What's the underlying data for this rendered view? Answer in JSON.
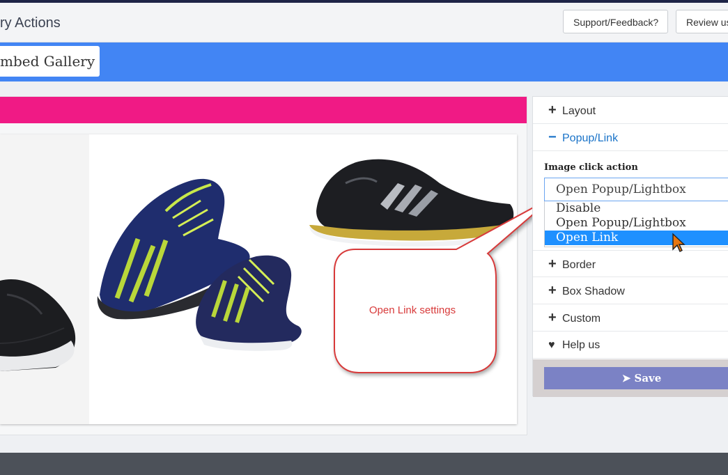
{
  "header": {
    "title": "ry Actions",
    "support_label": "Support/Feedback?",
    "review_label": "Review us"
  },
  "tabs": {
    "gallery_label": "mbed Gallery"
  },
  "sidebar": {
    "sections": [
      {
        "icon": "plus-icon",
        "label": "Layout"
      },
      {
        "icon": "minus-icon",
        "label": "Popup/Link"
      },
      {
        "icon": "plus-icon",
        "label": "Border"
      },
      {
        "icon": "plus-icon",
        "label": "Box Shadow"
      },
      {
        "icon": "plus-icon",
        "label": "Custom"
      },
      {
        "icon": "heart-icon",
        "label": "Help us"
      }
    ],
    "click_action": {
      "label": "Image click action",
      "value": "Open Popup/Lightbox",
      "options": [
        "Disable",
        "Open Popup/Lightbox",
        "Open Link"
      ],
      "highlighted": "Open Link"
    },
    "save_label": "Save"
  },
  "callout": {
    "text": "Open Link settings"
  },
  "colors": {
    "accent": "#4285f4",
    "pink": "#f01a85",
    "callout_border": "#d83a3a",
    "save_button": "#7b82c5",
    "highlight": "#1e90ff"
  }
}
